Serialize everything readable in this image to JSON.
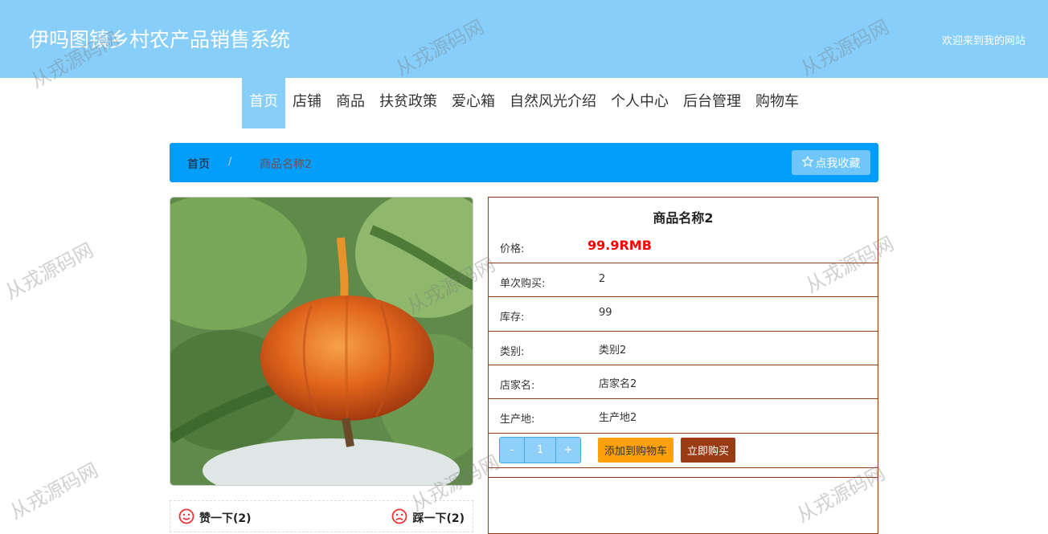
{
  "header": {
    "title": "伊吗图镇乡村农产品销售系统",
    "welcome": "欢迎来到我的网站"
  },
  "nav": {
    "items": [
      "首页",
      "店铺",
      "商品",
      "扶贫政策",
      "爱心箱",
      "自然风光介绍",
      "个人中心",
      "后台管理",
      "购物车"
    ],
    "active": "首页"
  },
  "breadcrumb": {
    "home": "首页",
    "separator": "/",
    "current": "商品名称2",
    "favorite_label": "点我收藏"
  },
  "product": {
    "name": "商品名称2",
    "price_label": "价格:",
    "price": "99.9RMB",
    "rows": [
      {
        "label": "单次购买:",
        "value": "2"
      },
      {
        "label": "库存:",
        "value": "99"
      },
      {
        "label": "类别:",
        "value": "类别2"
      },
      {
        "label": "店家名:",
        "value": "店家名2"
      },
      {
        "label": "生产地:",
        "value": "生产地2"
      }
    ],
    "quantity": "1",
    "minus": "-",
    "plus": "+",
    "add_to_cart": "添加到购物车",
    "buy_now": "立即购买"
  },
  "votes": {
    "like": "赞一下(2)",
    "dislike": "踩一下(2)"
  },
  "watermark": "从戎源码网",
  "colors": {
    "header": "#87cefa",
    "breadcrumb": "#039ef9",
    "price": "#ff0000",
    "cart": "#fba10c",
    "buy": "#9b3b15",
    "border": "#8b3b17"
  }
}
